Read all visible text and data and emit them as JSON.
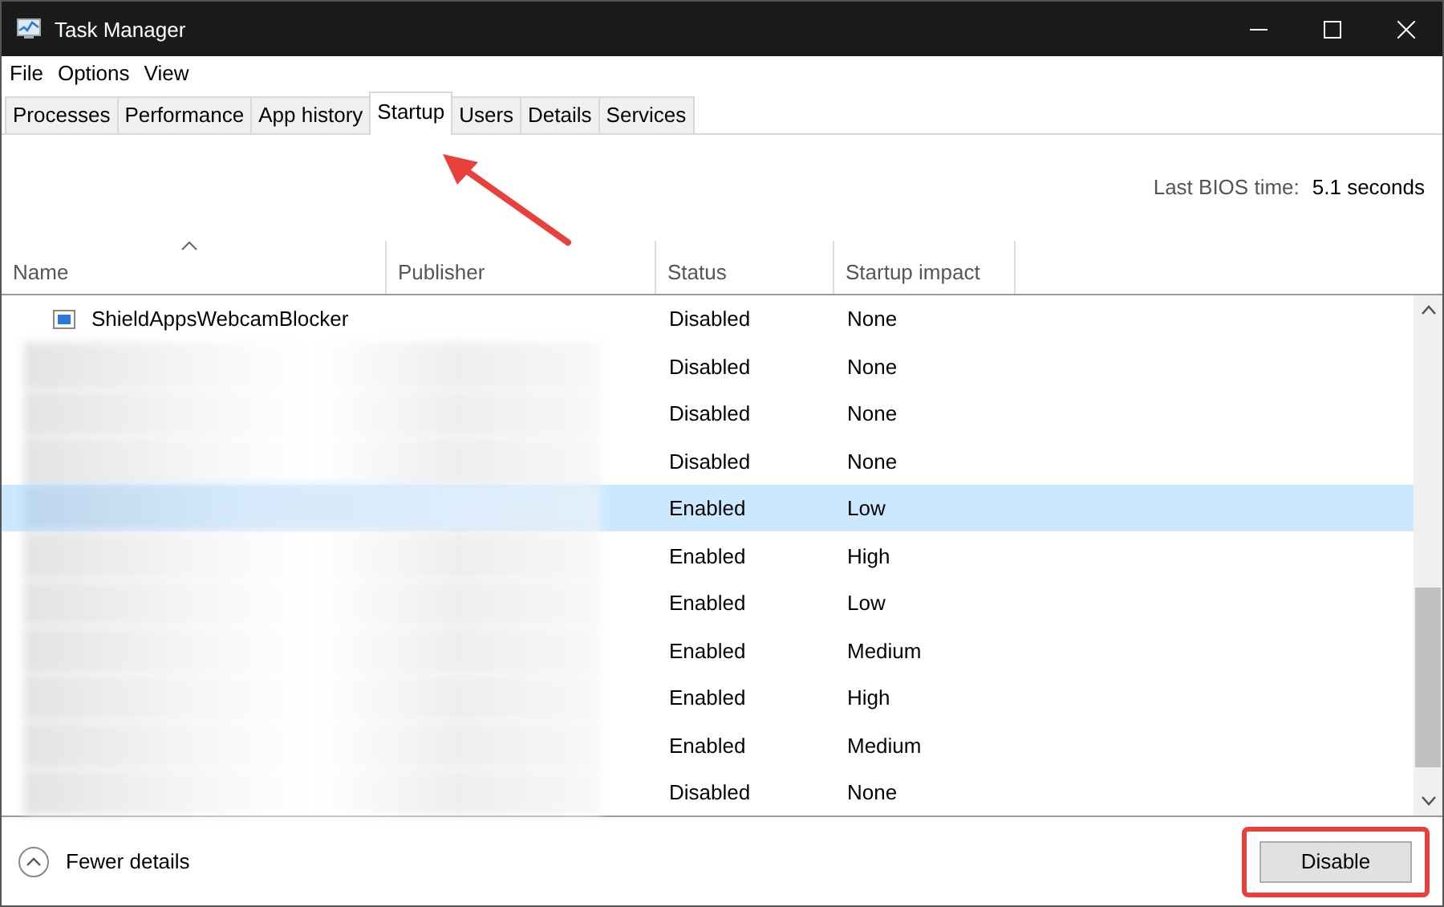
{
  "window": {
    "title": "Task Manager"
  },
  "menu": [
    "File",
    "Options",
    "View"
  ],
  "tabs": [
    {
      "label": "Processes",
      "selected": false
    },
    {
      "label": "Performance",
      "selected": false
    },
    {
      "label": "App history",
      "selected": false
    },
    {
      "label": "Startup",
      "selected": true
    },
    {
      "label": "Users",
      "selected": false
    },
    {
      "label": "Details",
      "selected": false
    },
    {
      "label": "Services",
      "selected": false
    }
  ],
  "bios": {
    "label": "Last BIOS time:",
    "value": "5.1 seconds"
  },
  "table": {
    "columns": [
      {
        "label": "Name",
        "sorted": true
      },
      {
        "label": "Publisher",
        "sorted": false
      },
      {
        "label": "Status",
        "sorted": false
      },
      {
        "label": "Startup impact",
        "sorted": false
      }
    ],
    "rows": [
      {
        "name": "ShieldAppsWebcamBlocker",
        "redacted": false,
        "status": "Disabled",
        "impact": "None",
        "selected": false
      },
      {
        "redacted": true,
        "status": "Disabled",
        "impact": "None",
        "selected": false
      },
      {
        "redacted": true,
        "status": "Disabled",
        "impact": "None",
        "selected": false
      },
      {
        "redacted": true,
        "status": "Disabled",
        "impact": "None",
        "selected": false
      },
      {
        "redacted": true,
        "status": "Enabled",
        "impact": "Low",
        "selected": true
      },
      {
        "redacted": true,
        "status": "Enabled",
        "impact": "High",
        "selected": false
      },
      {
        "redacted": true,
        "status": "Enabled",
        "impact": "Low",
        "selected": false
      },
      {
        "redacted": true,
        "status": "Enabled",
        "impact": "Medium",
        "selected": false
      },
      {
        "redacted": true,
        "status": "Enabled",
        "impact": "High",
        "selected": false
      },
      {
        "redacted": true,
        "status": "Enabled",
        "impact": "Medium",
        "selected": false
      },
      {
        "redacted": true,
        "status": "Disabled",
        "impact": "None",
        "selected": false
      }
    ]
  },
  "footer": {
    "toggle": "Fewer details",
    "button": {
      "label": "Disable",
      "highlighted": true
    }
  }
}
